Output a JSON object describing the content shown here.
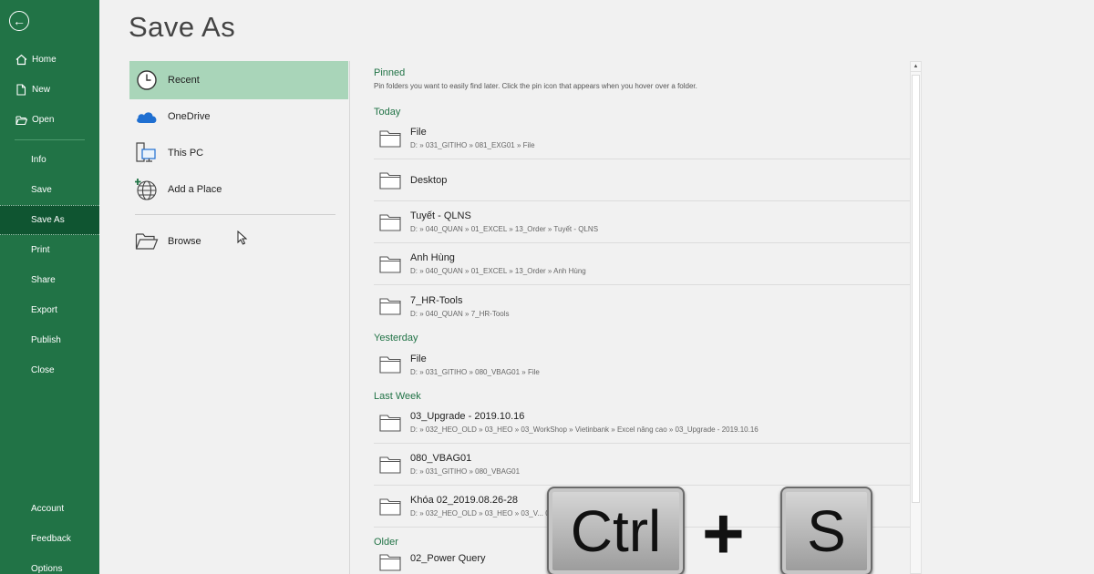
{
  "sidebar": {
    "back_icon": "back-arrow-icon",
    "top": [
      {
        "label": "Home",
        "icon": "home-icon"
      },
      {
        "label": "New",
        "icon": "new-document-icon"
      },
      {
        "label": "Open",
        "icon": "folder-open-icon"
      }
    ],
    "middle": [
      "Info",
      "Save",
      "Save As",
      "Print",
      "Share",
      "Export",
      "Publish",
      "Close"
    ],
    "active": "Save As",
    "bottom": [
      "Account",
      "Feedback",
      "Options"
    ]
  },
  "main": {
    "title": "Save As",
    "locations": [
      {
        "label": "Recent",
        "icon": "clock-icon"
      },
      {
        "label": "OneDrive",
        "icon": "cloud-icon"
      },
      {
        "label": "This PC",
        "icon": "computer-icon"
      },
      {
        "label": "Add a Place",
        "icon": "globe-add-icon"
      },
      {
        "label": "Browse",
        "icon": "folder-browse-icon"
      }
    ],
    "pinned": {
      "heading": "Pinned",
      "note": "Pin folders you want to easily find later. Click the pin icon that appears when you hover over a folder."
    },
    "today": {
      "heading": "Today",
      "items": [
        {
          "name": "File",
          "path": "D: » 031_GITIHO » 081_EXG01 » File"
        },
        {
          "name": "Desktop",
          "path": ""
        },
        {
          "name": "Tuyết - QLNS",
          "path": "D: » 040_QUAN » 01_EXCEL » 13_Order » Tuyết - QLNS"
        },
        {
          "name": "Anh Hùng",
          "path": "D: » 040_QUAN » 01_EXCEL » 13_Order » Anh Hùng"
        },
        {
          "name": "7_HR-Tools",
          "path": "D: » 040_QUAN » 7_HR-Tools"
        }
      ]
    },
    "yesterday": {
      "heading": "Yesterday",
      "items": [
        {
          "name": "File",
          "path": "D: » 031_GITIHO » 080_VBAG01 » File"
        }
      ]
    },
    "last_week": {
      "heading": "Last Week",
      "items": [
        {
          "name": "03_Upgrade - 2019.10.16",
          "path": "D: » 032_HEO_OLD » 03_HEO » 03_WorkShop » Vietinbank » Excel nâng cao » 03_Upgrade - 2019.10.16"
        },
        {
          "name": "080_VBAG01",
          "path": "D: » 031_GITIHO » 080_VBAG01"
        },
        {
          "name": "Khóa 02_2019.08.26-28",
          "path": "D: » 032_HEO_OLD » 03_HEO » 03_V... 02_2019.08.26-28"
        }
      ]
    },
    "older": {
      "heading": "Older",
      "items": [
        {
          "name": "02_Power Query",
          "path": ""
        }
      ]
    }
  },
  "overlay": {
    "key1": "Ctrl",
    "plus": "+",
    "key2": "S"
  }
}
